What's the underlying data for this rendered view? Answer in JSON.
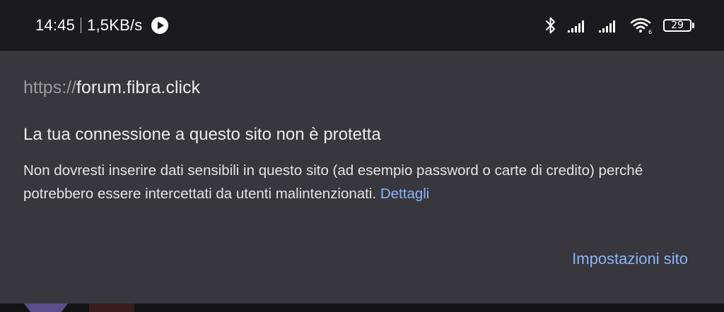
{
  "status_bar": {
    "time": "14:45",
    "net_speed": "1,5KB/s",
    "battery_level": "29",
    "icons": [
      "play-icon",
      "bluetooth-icon",
      "signal-icon",
      "signal-icon",
      "wifi-icon",
      "battery-icon"
    ]
  },
  "site_info": {
    "url_scheme": "https://",
    "url_host": "forum.fibra.click",
    "title": "La tua connessione a questo sito non è protetta",
    "description": "Non dovresti inserire dati sensibili in questo sito (ad esempio password o carte di credito) perché potrebbero essere intercettati da utenti malintenzionati.",
    "details_link": "Dettagli",
    "site_settings": "Impostazioni sito"
  },
  "colors": {
    "panel": "#38373d",
    "status_bar": "#1b1b1d",
    "link": "#8ab4f8"
  }
}
